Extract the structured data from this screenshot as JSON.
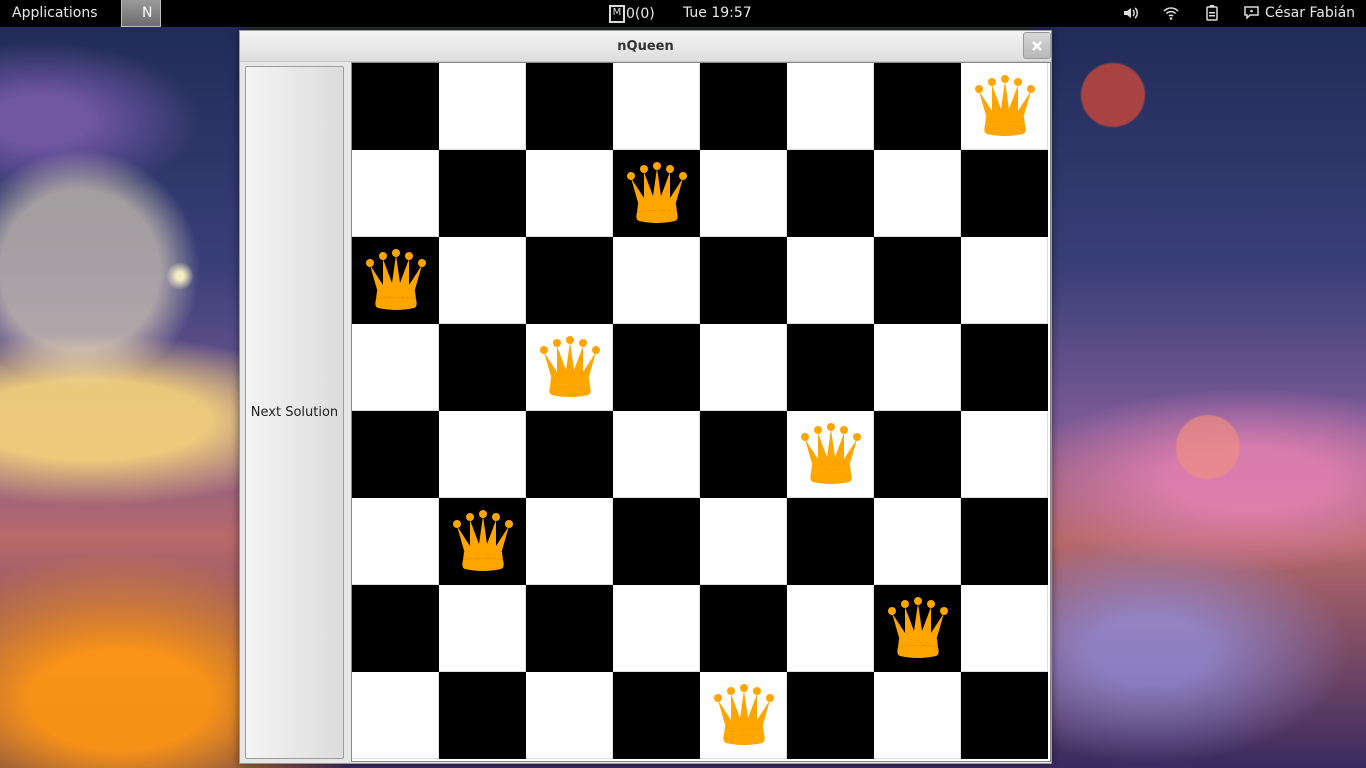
{
  "topbar": {
    "applications": "Applications",
    "task_label": "N",
    "mail_icon_letter": "M",
    "mail_count": "0(0)",
    "clock": "Tue 19:57",
    "user": "César Fabián"
  },
  "window": {
    "title": "nQueen",
    "close_icon": "close-icon",
    "next_button": "Next Solution"
  },
  "board": {
    "size": 8,
    "queens": [
      7,
      3,
      0,
      2,
      5,
      1,
      6,
      4
    ],
    "dark_color": "#000000",
    "light_color": "#ffffff",
    "queen_color": "#ffa500"
  }
}
